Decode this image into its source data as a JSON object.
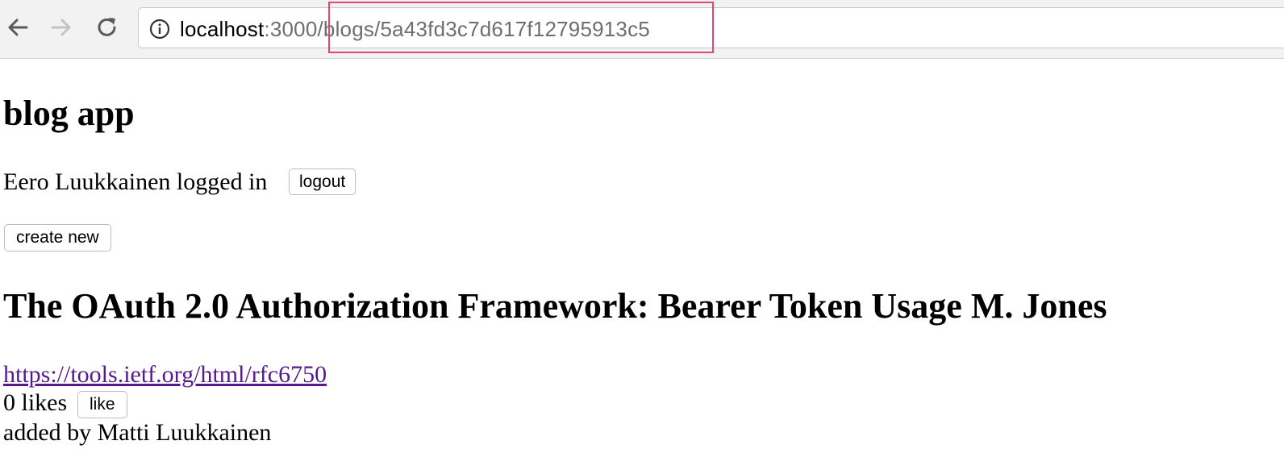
{
  "browser": {
    "url_host": "localhost",
    "url_rest_pre": ":3000",
    "url_rest_path": "/blogs/5a43fd3c7d617f12795913c5"
  },
  "app": {
    "title": "blog app",
    "login_status": "Eero Luukkainen logged in",
    "logout_label": "logout",
    "create_new_label": "create new"
  },
  "blog": {
    "title": "The OAuth 2.0 Authorization Framework: Bearer Token Usage M. Jones",
    "url": "https://tools.ietf.org/html/rfc6750",
    "likes_text": "0 likes",
    "like_label": "like",
    "added_by": "added by Matti Luukkainen"
  },
  "colors": {
    "highlight_border": "#e0457b",
    "visited_link": "#551a8b"
  }
}
